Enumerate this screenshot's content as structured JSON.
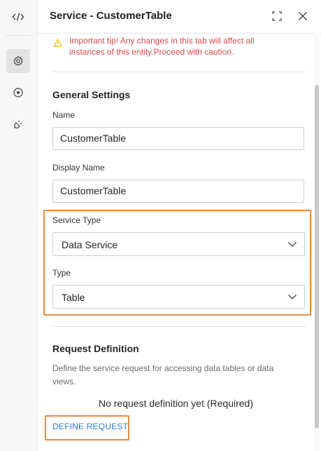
{
  "rail": {
    "items": [
      {
        "name": "code-icon"
      },
      {
        "name": "gear-icon",
        "active": true
      },
      {
        "name": "target-icon"
      },
      {
        "name": "plug-icon"
      }
    ]
  },
  "header": {
    "title": "Service - CustomerTable",
    "icons": [
      "expand-icon",
      "close-icon"
    ]
  },
  "warning": {
    "text": "Important tip! Any changes in this tab will affect all instances of this entity.Proceed with caution."
  },
  "general": {
    "title": "General Settings",
    "name_label": "Name",
    "name_value": "CustomerTable",
    "display_name_label": "Display Name",
    "display_name_value": "CustomerTable",
    "service_type_label": "Service Type",
    "service_type_value": "Data Service",
    "type_label": "Type",
    "type_value": "Table"
  },
  "request": {
    "title": "Request Definition",
    "description": "Define the service request for accessing data tables or data views.",
    "empty_note": "No request definition yet (Required)",
    "define_label": "DEFINE REQUEST"
  },
  "colors": {
    "warning": "#e0474c",
    "highlight": "#ee8a3a",
    "link": "#2b7de0",
    "warn_icon": "#f2b705"
  }
}
